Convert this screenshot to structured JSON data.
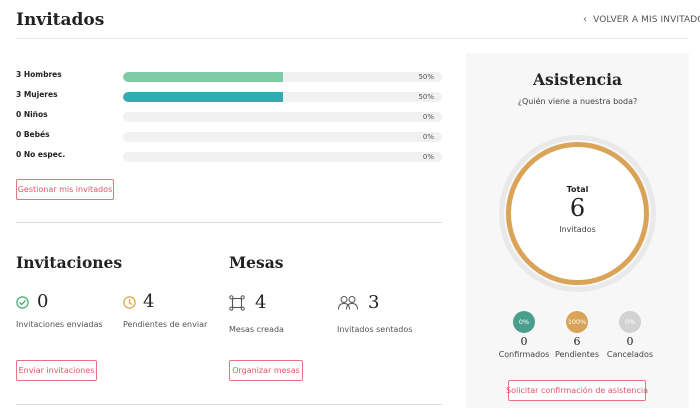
{
  "header": {
    "title": "Invitados",
    "back_label": "VOLVER A MIS INVITADOS"
  },
  "guest_stats": [
    {
      "label": "3 Hombres",
      "percent_text": "50%",
      "fill": 0.5,
      "color": "#7fcba6"
    },
    {
      "label": "3 Mujeres",
      "percent_text": "50%",
      "fill": 0.5,
      "color": "#36a9b3"
    },
    {
      "label": "0 Niños",
      "percent_text": "0%",
      "fill": 0,
      "color": "#7fcba6"
    },
    {
      "label": "0 Bebés",
      "percent_text": "0%",
      "fill": 0,
      "color": "#7fcba6"
    },
    {
      "label": "0 No espec.",
      "percent_text": "0%",
      "fill": 0,
      "color": "#7fcba6"
    }
  ],
  "manage_button": "Gestionar mis invitados",
  "invitations": {
    "title": "Invitaciones",
    "sent_count": "0",
    "sent_label": "Invitaciones enviadas",
    "pending_count": "4",
    "pending_label": "Pendientes de enviar",
    "button": "Enviar invitaciones"
  },
  "tables": {
    "title": "Mesas",
    "created_count": "4",
    "created_label": "Mesas creada",
    "seated_count": "3",
    "seated_label": "Invitados sentados",
    "button": "Organizar mesas"
  },
  "attendance": {
    "title": "Asistencia",
    "subtitle": "¿Quién viene a nuestra boda?",
    "total_label": "Total",
    "total_value": "6",
    "total_unit": "Invitados",
    "ring_fill": 1.0,
    "ring_color": "#d9a458",
    "statuses": [
      {
        "percent": "0%",
        "count": "0",
        "label": "Confirmados",
        "color": "#4a9f8c"
      },
      {
        "percent": "100%",
        "count": "6",
        "label": "Pendientes",
        "color": "#d9a458"
      },
      {
        "percent": "0%",
        "count": "0",
        "label": "Cancelados",
        "color": "#d2d2d2"
      }
    ],
    "button": "Solicitar confirmación de asistencia"
  },
  "icons": {
    "back": "chevron-left-icon",
    "sent": "check-circle-icon",
    "pending": "clock-icon",
    "tables": "table-icon",
    "seated": "people-icon"
  }
}
